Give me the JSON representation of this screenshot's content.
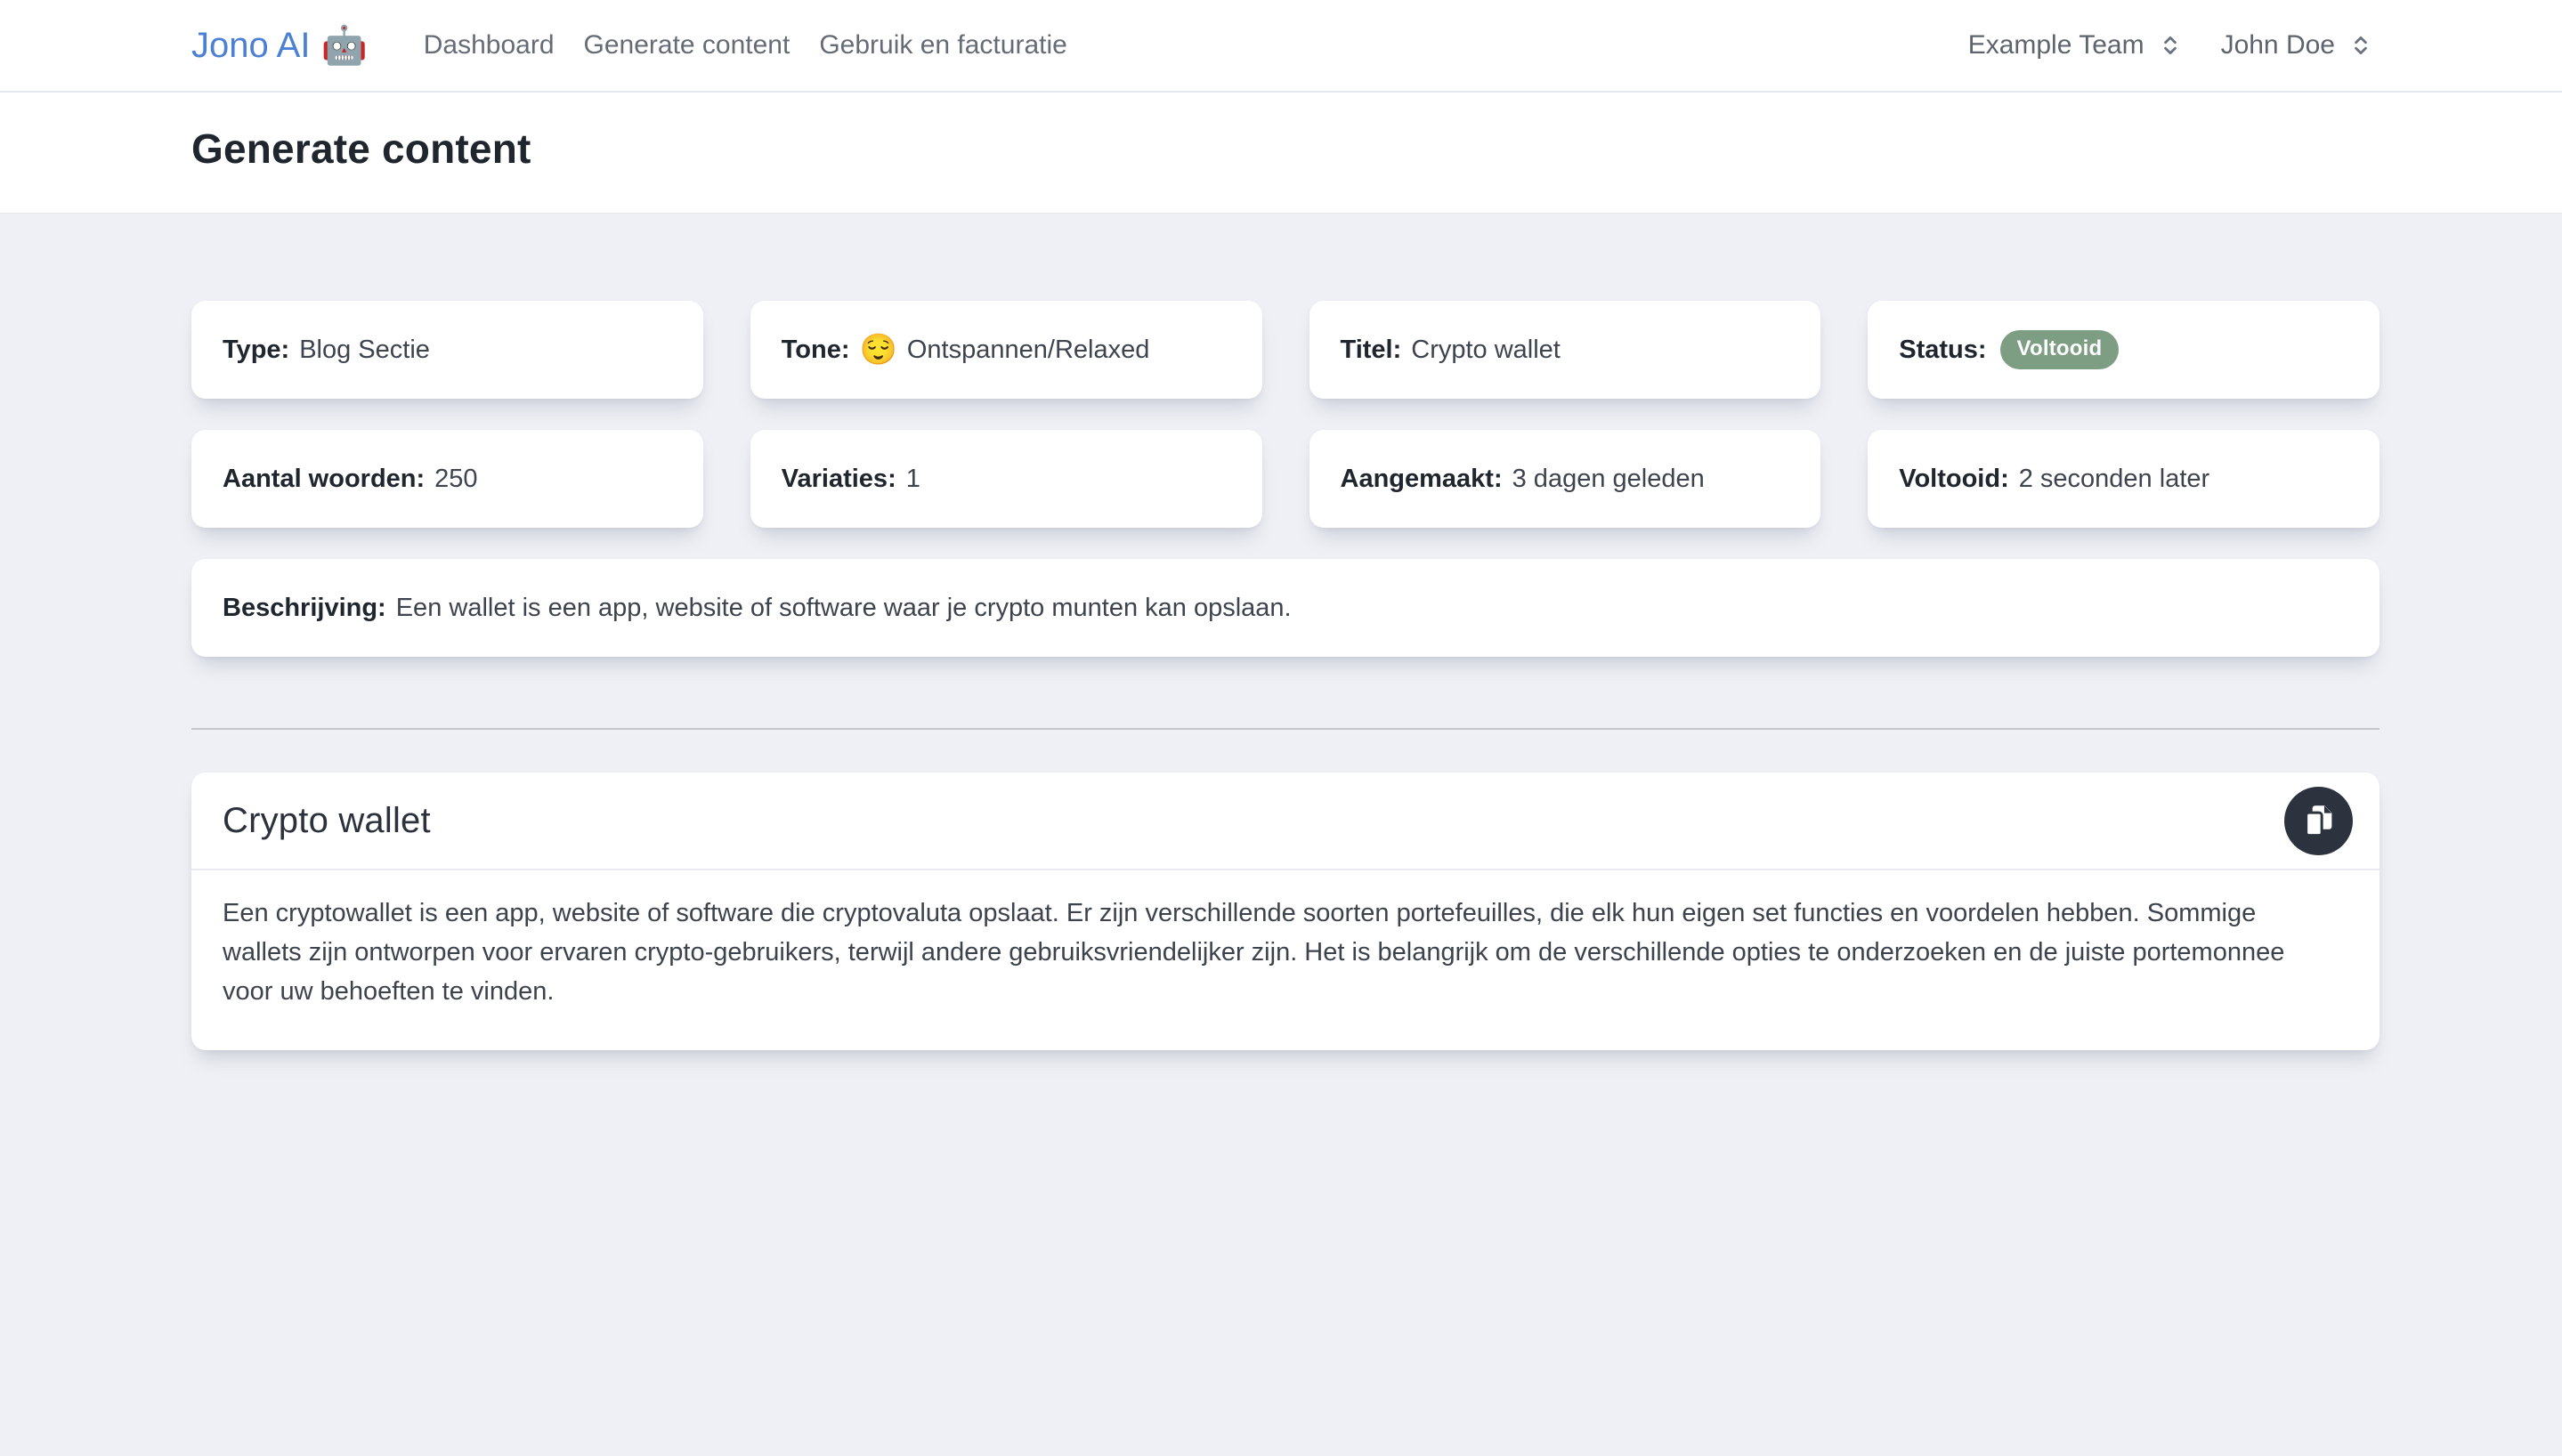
{
  "brand": {
    "name": "Jono AI",
    "emoji": "🤖"
  },
  "nav": {
    "items": [
      "Dashboard",
      "Generate content",
      "Gebruik en facturatie"
    ]
  },
  "header_right": {
    "team": "Example Team",
    "user": "John Doe"
  },
  "page": {
    "title": "Generate content"
  },
  "details": {
    "cards": [
      {
        "label": "Type:",
        "value": "Blog Sectie"
      },
      {
        "label": "Tone:",
        "emoji": "😌",
        "value": "Ontspannen/Relaxed"
      },
      {
        "label": "Titel:",
        "value": "Crypto wallet"
      },
      {
        "label": "Status:",
        "badge": "Voltooid"
      },
      {
        "label": "Aantal woorden:",
        "value": "250"
      },
      {
        "label": "Variaties:",
        "value": "1"
      },
      {
        "label": "Aangemaakt:",
        "value": "3 dagen geleden"
      },
      {
        "label": "Voltooid:",
        "value": "2 seconden later"
      }
    ],
    "description": {
      "label": "Beschrijving:",
      "value": "Een wallet is een app, website of software waar je crypto munten kan opslaan."
    }
  },
  "result": {
    "title": "Crypto wallet",
    "body": "Een cryptowallet is een app, website of software die cryptovaluta opslaat. Er zijn verschillende soorten portefeuilles, die elk hun eigen set functies en voordelen hebben. Sommige wallets zijn ontworpen voor ervaren crypto-gebruikers, terwijl andere gebruiksvriendelijker zijn. Het is belangrijk om de verschillende opties te onderzoeken en de juiste portemonnee voor uw behoeften te vinden."
  },
  "icons": {
    "team_selector": "chevron-up-down",
    "user_menu": "chevron-up-down",
    "copy": "copy-pages"
  },
  "colors": {
    "brand_blue": "#4b80d5",
    "badge_green": "#7d9e83",
    "copy_button_dark": "#2c333e",
    "page_background": "#eef0f5"
  }
}
